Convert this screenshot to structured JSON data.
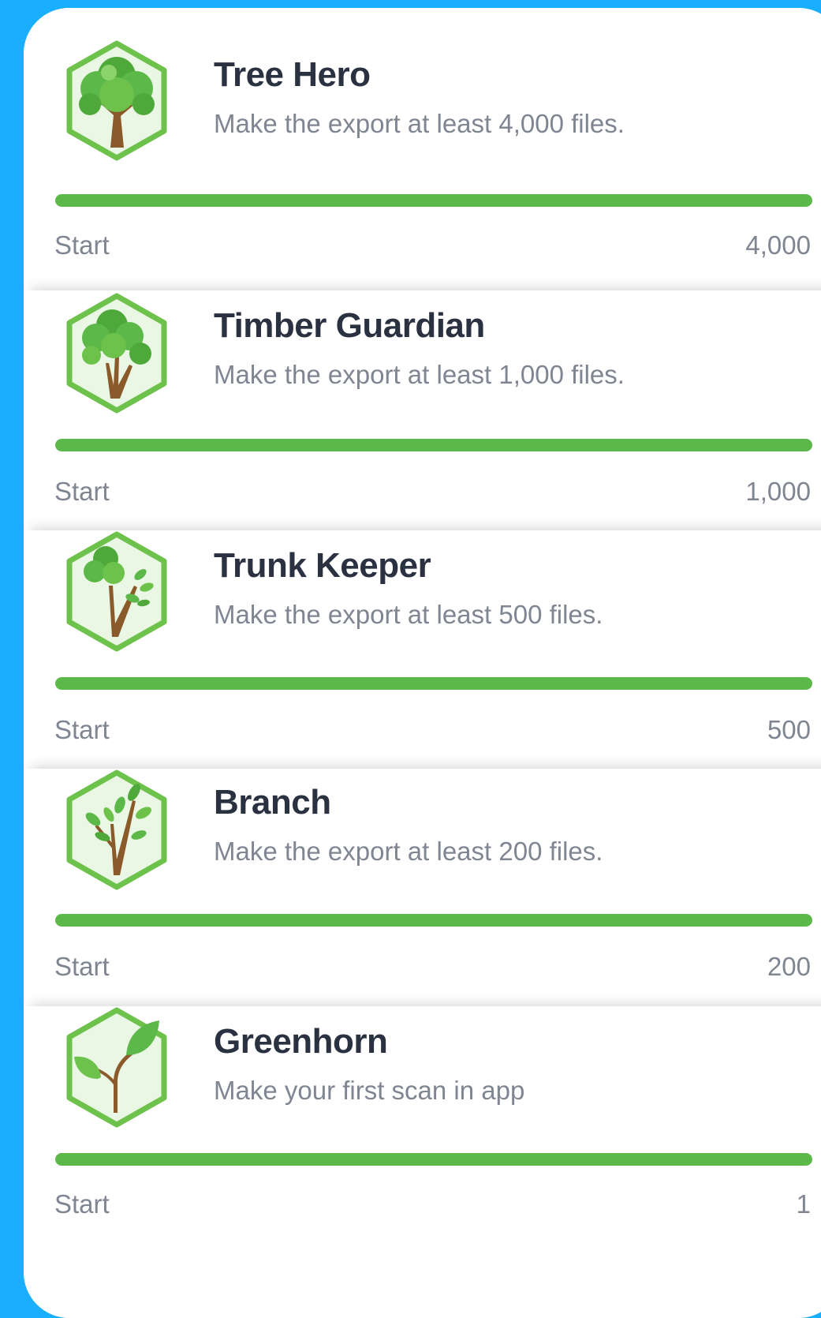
{
  "achievements": [
    {
      "title": "Tree Hero",
      "description": "Make the export at least 4,000 files.",
      "start_label": "Start",
      "goal_label": "4,000",
      "progress": 1.0,
      "icon": "big-tree-icon"
    },
    {
      "title": "Timber Guardian",
      "description": "Make the export at least 1,000 files.",
      "start_label": "Start",
      "goal_label": "1,000",
      "progress": 1.0,
      "icon": "tree-icon"
    },
    {
      "title": "Trunk Keeper",
      "description": "Make the export at least 500 files.",
      "start_label": "Start",
      "goal_label": "500",
      "progress": 1.0,
      "icon": "young-tree-icon"
    },
    {
      "title": "Branch",
      "description": "Make the export at least 200 files.",
      "start_label": "Start",
      "goal_label": "200",
      "progress": 1.0,
      "icon": "branch-icon"
    },
    {
      "title": "Greenhorn",
      "description": "Make your first scan in app",
      "start_label": "Start",
      "goal_label": "1",
      "progress": 1.0,
      "icon": "sprout-icon"
    }
  ],
  "colors": {
    "background": "#1aaeff",
    "progress": "#5cb848",
    "badge_border": "#6cc24a",
    "badge_fill": "#eaf7e4"
  }
}
